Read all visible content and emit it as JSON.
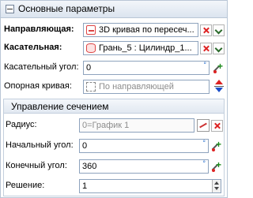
{
  "header": {
    "title": "Основные параметры"
  },
  "rows": {
    "guide": {
      "label": "Направляющая:",
      "value": "3D кривая по пересеч..."
    },
    "tangent": {
      "label": "Касательная:",
      "value": "Грань_5 : Цилиндр_1..."
    },
    "tangent_angle": {
      "label": "Касательный угол:",
      "value": "0",
      "unit": "°"
    },
    "ref_curve": {
      "label": "Опорная кривая:",
      "value": "По направляющей"
    }
  },
  "section": {
    "title": "Управление сечением",
    "radius": {
      "label": "Радиус:",
      "value": "0=График 1"
    },
    "start_angle": {
      "label": "Начальный угол:",
      "value": "0",
      "unit": "°"
    },
    "end_angle": {
      "label": "Конечный угол:",
      "value": "360",
      "unit": "°"
    },
    "solution": {
      "label": "Решение:",
      "value": "1"
    }
  }
}
